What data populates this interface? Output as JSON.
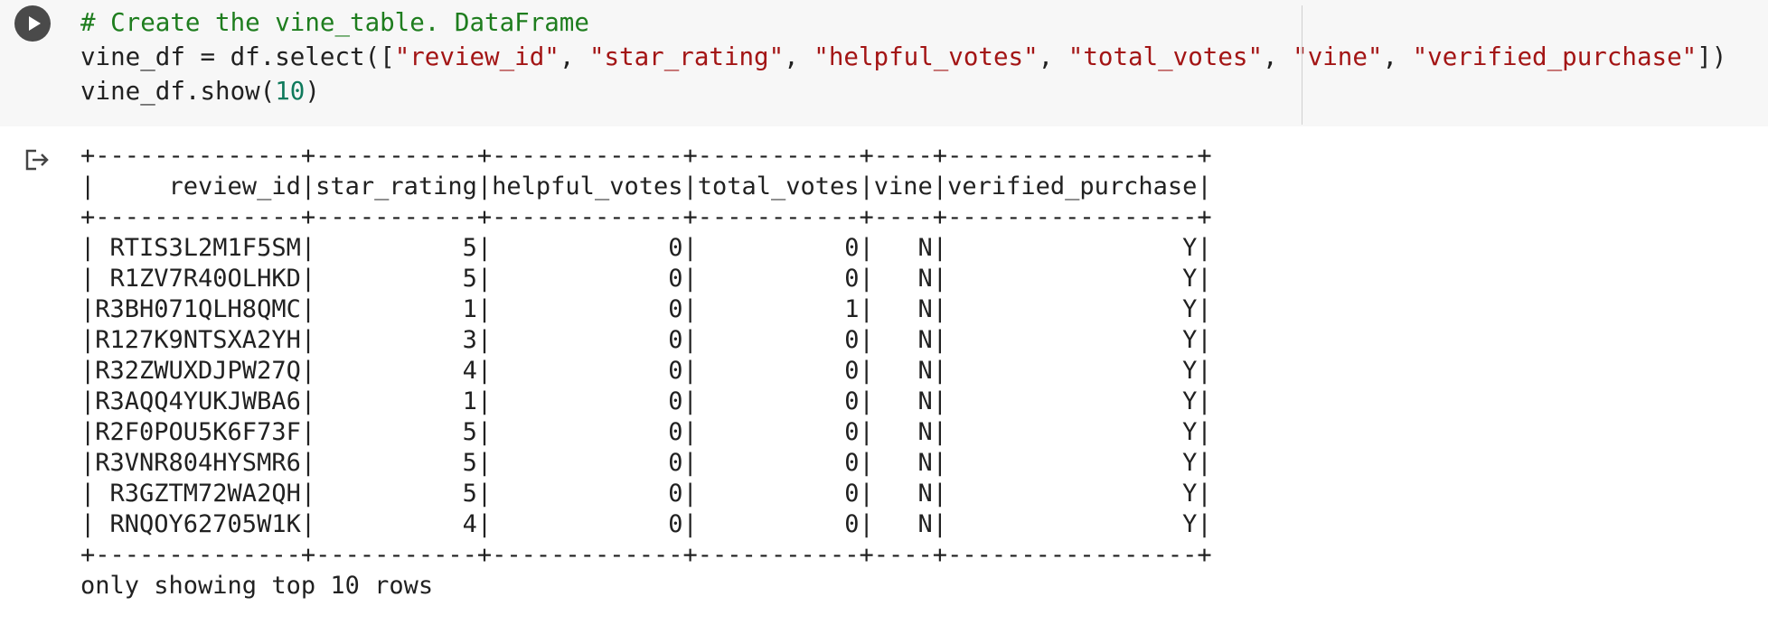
{
  "code_cell": {
    "run_button_label": "",
    "lines": [
      [
        {
          "t": "# Create the vine_table. DataFrame",
          "c": "comment"
        }
      ],
      [
        {
          "t": "vine_df = df.select([",
          "c": "plain"
        },
        {
          "t": "\"review_id\"",
          "c": "string"
        },
        {
          "t": ", ",
          "c": "plain"
        },
        {
          "t": "\"star_rating\"",
          "c": "string"
        },
        {
          "t": ", ",
          "c": "plain"
        },
        {
          "t": "\"helpful_votes\"",
          "c": "string"
        },
        {
          "t": ", ",
          "c": "plain"
        },
        {
          "t": "\"total_votes\"",
          "c": "string"
        },
        {
          "t": ", ",
          "c": "plain"
        },
        {
          "t": "\"vine\"",
          "c": "string"
        },
        {
          "t": ", ",
          "c": "plain"
        },
        {
          "t": "\"verified_purchase\"",
          "c": "string"
        },
        {
          "t": "])",
          "c": "plain"
        }
      ],
      [
        {
          "t": "vine_df.show(",
          "c": "plain"
        },
        {
          "t": "10",
          "c": "number"
        },
        {
          "t": ")",
          "c": "plain"
        }
      ]
    ]
  },
  "output": {
    "icon": "output-icon",
    "lines": [
      "+--------------+-----------+-------------+-----------+----+-----------------+",
      "|     review_id|star_rating|helpful_votes|total_votes|vine|verified_purchase|",
      "+--------------+-----------+-------------+-----------+----+-----------------+",
      "| RTIS3L2M1F5SM|          5|            0|          0|   N|                Y|",
      "| R1ZV7R40OLHKD|          5|            0|          0|   N|                Y|",
      "|R3BH071QLH8QMC|          1|            0|          1|   N|                Y|",
      "|R127K9NTSXA2YH|          3|            0|          0|   N|                Y|",
      "|R32ZWUXDJPW27Q|          4|            0|          0|   N|                Y|",
      "|R3AQQ4YUKJWBA6|          1|            0|          0|   N|                Y|",
      "|R2F0POU5K6F73F|          5|            0|          0|   N|                Y|",
      "|R3VNR804HYSMR6|          5|            0|          0|   N|                Y|",
      "| R3GZTM72WA2QH|          5|            0|          0|   N|                Y|",
      "| RNQOY62705W1K|          4|            0|          0|   N|                Y|",
      "+--------------+-----------+-------------+-----------+----+-----------------+",
      "only showing top 10 rows"
    ]
  }
}
